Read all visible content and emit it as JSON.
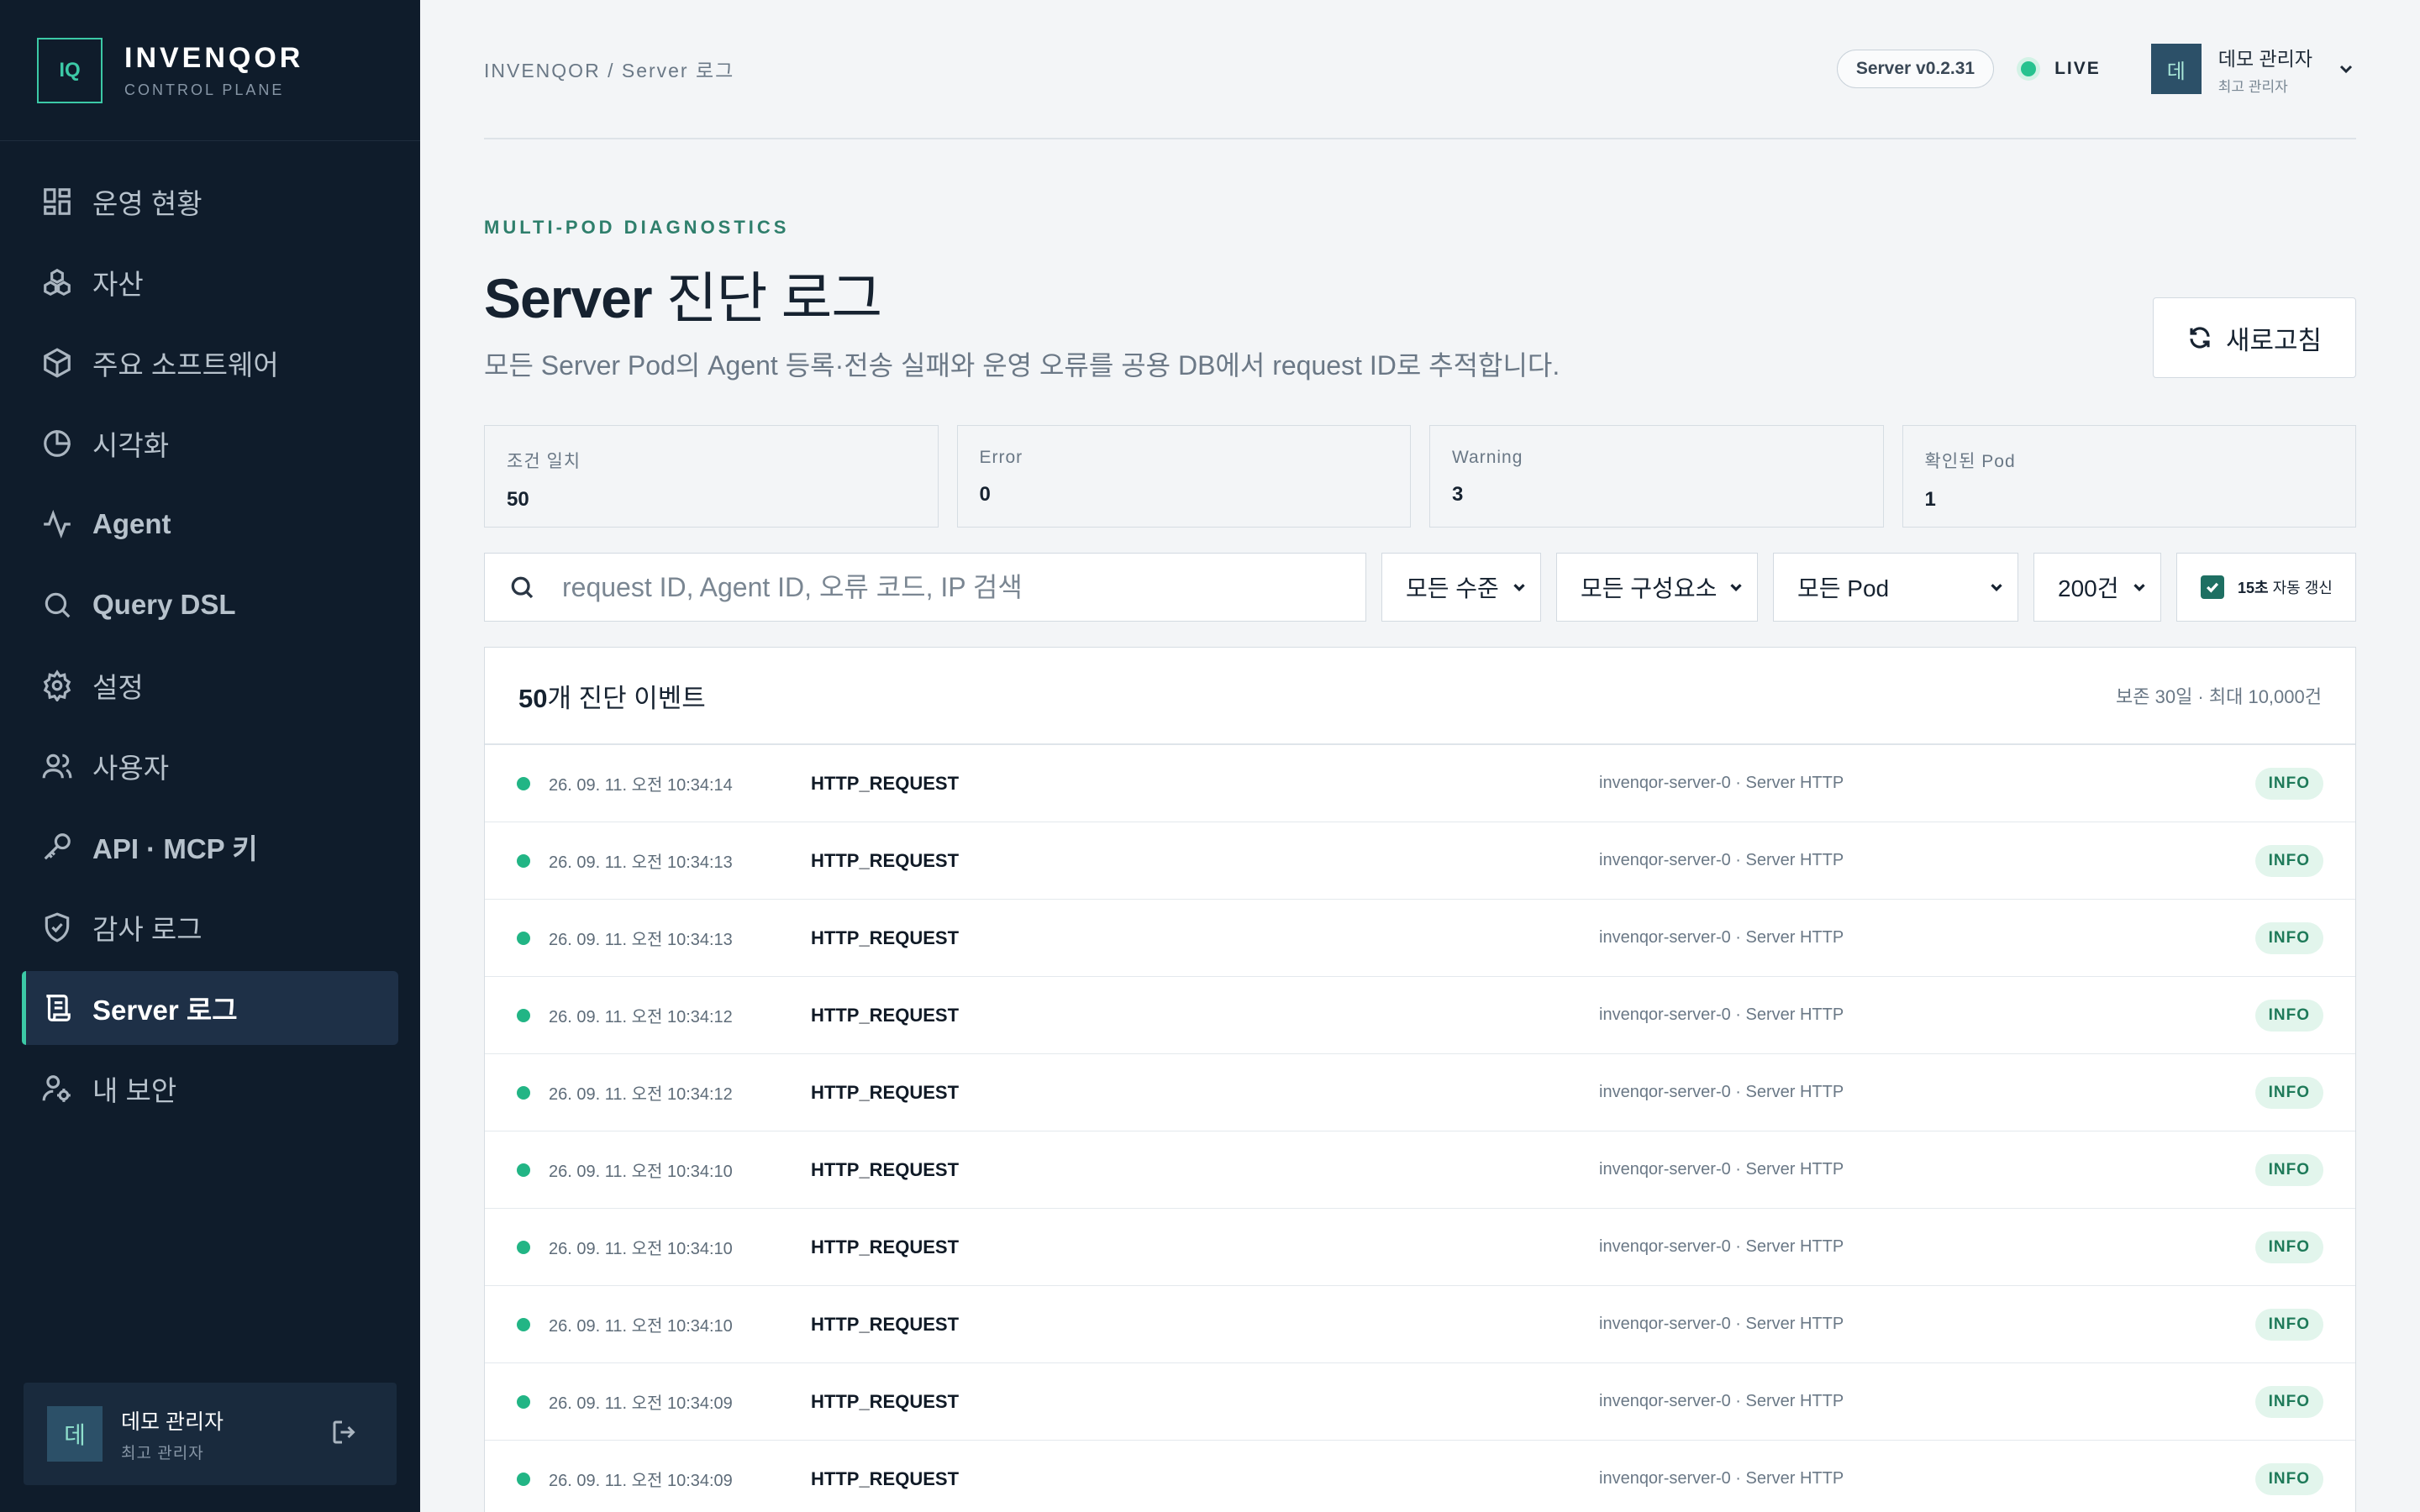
{
  "brand": {
    "logo": "IQ",
    "name": "INVENQOR",
    "sub": "CONTROL PLANE"
  },
  "sidebar": {
    "items": [
      {
        "label": "운영 현황",
        "icon": "dashboard-icon"
      },
      {
        "label": "자산",
        "icon": "assets-icon"
      },
      {
        "label": "주요 소프트웨어",
        "icon": "package-icon"
      },
      {
        "label": "시각화",
        "icon": "pie-chart-icon"
      },
      {
        "label": "Agent",
        "icon": "activity-icon"
      },
      {
        "label": "Query DSL",
        "icon": "search-icon"
      },
      {
        "label": "설정",
        "icon": "gear-icon"
      },
      {
        "label": "사용자",
        "icon": "users-icon"
      },
      {
        "label": "API · MCP 키",
        "icon": "key-icon"
      },
      {
        "label": "감사 로그",
        "icon": "shield-icon"
      },
      {
        "label": "Server 로그",
        "icon": "scroll-icon"
      },
      {
        "label": "내 보안",
        "icon": "user-lock-icon"
      }
    ],
    "active_index": 10,
    "user": {
      "avatar": "데",
      "name": "데모 관리자",
      "role": "최고 관리자"
    }
  },
  "header": {
    "breadcrumb": "INVENQOR / Server 로그",
    "version": "Server v0.2.31",
    "live": "LIVE",
    "user": {
      "avatar": "데",
      "name": "데모 관리자",
      "role": "최고 관리자"
    }
  },
  "page": {
    "eyebrow": "MULTI-POD DIAGNOSTICS",
    "title_strong": "Server",
    "title_light": " 진단 로그",
    "subtitle": "모든 Server Pod의 Agent 등록·전송 실패와 운영 오류를 공용 DB에서 request ID로 추적합니다.",
    "refresh_label": "새로고침"
  },
  "stats": [
    {
      "label": "조건 일치",
      "value": "50"
    },
    {
      "label": "Error",
      "value": "0"
    },
    {
      "label": "Warning",
      "value": "3"
    },
    {
      "label": "확인된 Pod",
      "value": "1"
    }
  ],
  "filters": {
    "search_placeholder": "request ID, Agent ID, 오류 코드, IP 검색",
    "level": "모든 수준",
    "component": "모든 구성요소",
    "pod": "모든 Pod",
    "limit": "200건",
    "auto_refresh_strong": "15초",
    "auto_refresh_rest": " 자동 갱신",
    "auto_refresh_checked": true
  },
  "list": {
    "count": "50",
    "title_rest": "개 진단 이벤트",
    "meta": "보존 30일 · 최대 10,000건",
    "rows": [
      {
        "time": "26. 09. 11. 오전 10:34:14",
        "event": "HTTP_REQUEST",
        "source": "invenqor-server-0 · Server HTTP",
        "level": "INFO"
      },
      {
        "time": "26. 09. 11. 오전 10:34:13",
        "event": "HTTP_REQUEST",
        "source": "invenqor-server-0 · Server HTTP",
        "level": "INFO"
      },
      {
        "time": "26. 09. 11. 오전 10:34:13",
        "event": "HTTP_REQUEST",
        "source": "invenqor-server-0 · Server HTTP",
        "level": "INFO"
      },
      {
        "time": "26. 09. 11. 오전 10:34:12",
        "event": "HTTP_REQUEST",
        "source": "invenqor-server-0 · Server HTTP",
        "level": "INFO"
      },
      {
        "time": "26. 09. 11. 오전 10:34:12",
        "event": "HTTP_REQUEST",
        "source": "invenqor-server-0 · Server HTTP",
        "level": "INFO"
      },
      {
        "time": "26. 09. 11. 오전 10:34:10",
        "event": "HTTP_REQUEST",
        "source": "invenqor-server-0 · Server HTTP",
        "level": "INFO"
      },
      {
        "time": "26. 09. 11. 오전 10:34:10",
        "event": "HTTP_REQUEST",
        "source": "invenqor-server-0 · Server HTTP",
        "level": "INFO"
      },
      {
        "time": "26. 09. 11. 오전 10:34:10",
        "event": "HTTP_REQUEST",
        "source": "invenqor-server-0 · Server HTTP",
        "level": "INFO"
      },
      {
        "time": "26. 09. 11. 오전 10:34:09",
        "event": "HTTP_REQUEST",
        "source": "invenqor-server-0 · Server HTTP",
        "level": "INFO"
      },
      {
        "time": "26. 09. 11. 오전 10:34:09",
        "event": "HTTP_REQUEST",
        "source": "invenqor-server-0 · Server HTTP",
        "level": "INFO"
      }
    ]
  },
  "colors": {
    "accent": "#3cc9a6",
    "sidebar_bg": "#0f1c2b",
    "status_ok": "#22b585"
  }
}
